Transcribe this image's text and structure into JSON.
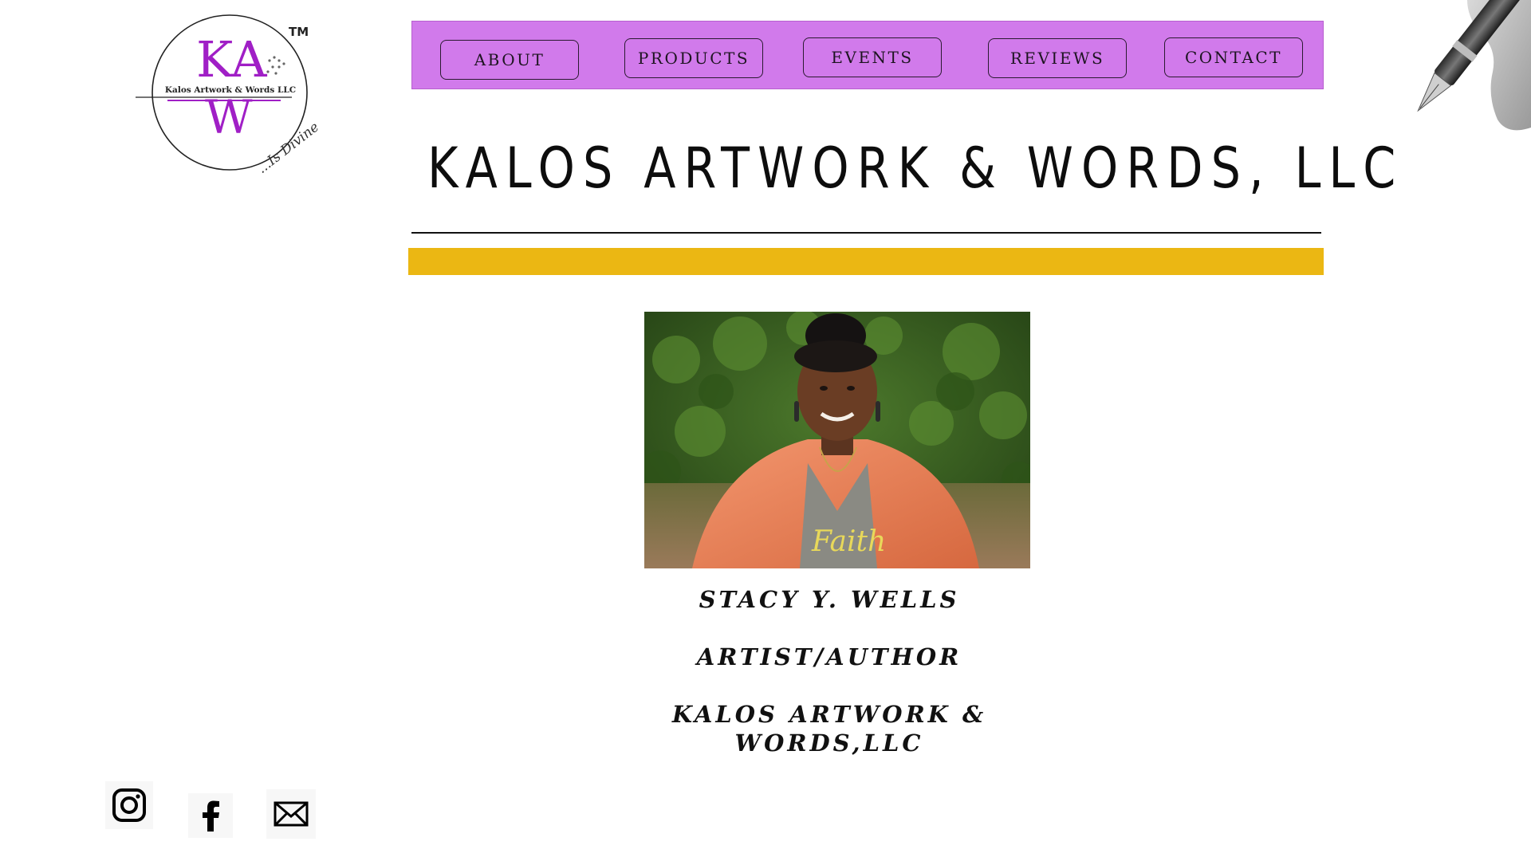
{
  "brand": {
    "logo_letters_top": "KA",
    "logo_letters_bottom": "W",
    "logo_company": "Kalos Artwork & Words LLC",
    "logo_tagline": "...Is Divine",
    "trademark": "TM",
    "accent_color": "#a01fc6"
  },
  "nav": {
    "background": "#d17aeb",
    "items": [
      {
        "label": "ABOUT"
      },
      {
        "label": "PRODUCTS"
      },
      {
        "label": "EVENTS"
      },
      {
        "label": "REVIEWS"
      },
      {
        "label": "CONTACT"
      }
    ]
  },
  "header": {
    "title": "KALOS ARTWORK & WORDS, LLC",
    "band_color": "#ebb713"
  },
  "profile": {
    "shirt_text": "Faith",
    "name": "STACY Y. WELLS",
    "role": "ARTIST/AUTHOR",
    "company_line1": "KALOS ARTWORK &",
    "company_line2": "WORDS,LLC"
  },
  "social": [
    {
      "icon": "instagram-icon"
    },
    {
      "icon": "facebook-icon"
    },
    {
      "icon": "email-icon"
    }
  ]
}
